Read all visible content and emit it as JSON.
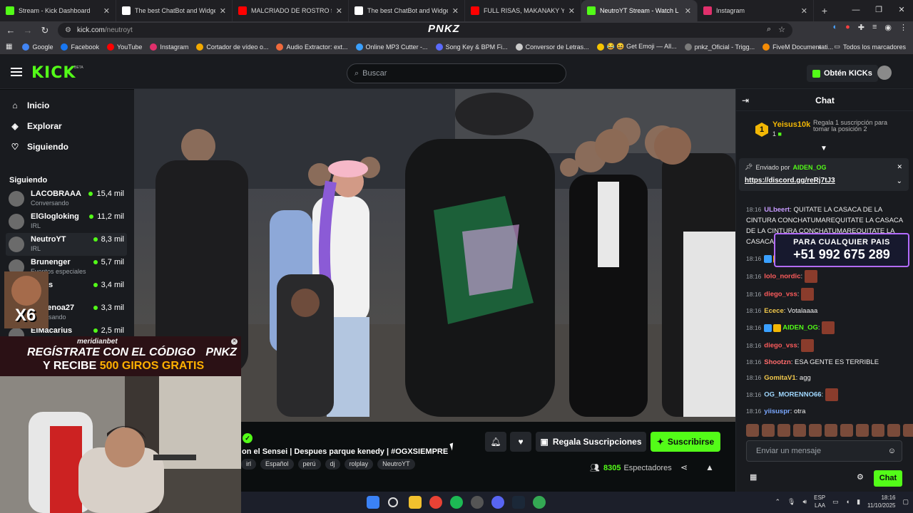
{
  "browser": {
    "tabs": [
      {
        "title": "Stream - Kick Dashboard",
        "icon": "kick-icon",
        "color": "#53fc18"
      },
      {
        "title": "The best ChatBot and Widgets",
        "icon": "botrix-icon",
        "color": "#ffffff"
      },
      {
        "title": "MALCRIADO DE ROSTRO ft. PN",
        "icon": "youtube-icon",
        "color": "#ff0000"
      },
      {
        "title": "The best ChatBot and Widgets",
        "icon": "botrix-icon",
        "color": "#ffffff"
      },
      {
        "title": "FULL RISAS, MAKANAKY Y",
        "icon": "youtube-icon",
        "color": "#ff0000"
      },
      {
        "title": "NeutroYT Stream - Watch L",
        "icon": "kick-icon",
        "color": "#53fc18"
      },
      {
        "title": "Instagram",
        "icon": "instagram-icon",
        "color": "#e1306c"
      }
    ],
    "url_host": "kick.com",
    "url_path": "/neutroyt",
    "overlay_logo": "PNKZ",
    "bookmarks": [
      {
        "label": "Google",
        "color": "#4285f4"
      },
      {
        "label": "Facebook",
        "color": "#1877f2"
      },
      {
        "label": "YouTube",
        "color": "#ff0000"
      },
      {
        "label": "Instagram",
        "color": "#e1306c"
      },
      {
        "label": "Cortador de vídeo o...",
        "color": "#f2a900"
      },
      {
        "label": "Audio Extractor: ext...",
        "color": "#f06a3c"
      },
      {
        "label": "Online MP3 Cutter -...",
        "color": "#3aa0ff"
      },
      {
        "label": "Song Key & BPM Fi...",
        "color": "#5b6bff"
      },
      {
        "label": "Conversor de Letras...",
        "color": "#cccccc"
      },
      {
        "label": "😂 😆 Get Emoji — All...",
        "color": "#f5c400"
      },
      {
        "label": "pnkz_Oficial - Trigg...",
        "color": "#7a7a7a"
      },
      {
        "label": "FiveM Documentati...",
        "color": "#f48c06"
      }
    ],
    "all_bookmarks": "Todos los marcadores"
  },
  "kick": {
    "logo": "KICK",
    "beta": "BETA",
    "search_placeholder": "Buscar",
    "kicks_button": "Obtén KICKs",
    "nav": [
      {
        "label": "Inicio",
        "icon": "home-icon"
      },
      {
        "label": "Explorar",
        "icon": "compass-icon"
      },
      {
        "label": "Siguiendo",
        "icon": "heart-icon"
      }
    ],
    "following_heading": "Siguiendo",
    "channels": [
      {
        "name": "LACOBRAAA",
        "category": "Conversando",
        "viewers": "15,4 mil"
      },
      {
        "name": "ElGlogloking",
        "category": "IRL",
        "viewers": "11,2 mil"
      },
      {
        "name": "NeutroYT",
        "category": "IRL",
        "viewers": "8,3 mil"
      },
      {
        "name": "Brunenger",
        "category": "Eventos especiales",
        "viewers": "5,7 mil"
      },
      {
        "name": "...ukis",
        "category": "",
        "viewers": "3,4 mil"
      },
      {
        "name": "...rmenoa27",
        "category": "...nversando",
        "viewers": "3,3 mil"
      },
      {
        "name": "ElMacarius",
        "category": "",
        "viewers": "2,5 mil"
      }
    ]
  },
  "stream": {
    "title": "on el Sensei | Despues parque kenedy | #OGXSIEMPRE",
    "tags": [
      "irl",
      "Español",
      "perú",
      "dj",
      "rolplay",
      "NeutroYT"
    ],
    "gift_button": "Regala Suscripciones",
    "subscribe_button": "Suscribirse",
    "viewers_count": "8305",
    "viewers_label": "Espectadores"
  },
  "overlay": {
    "ad_brand": "meridianbet",
    "ad_line1": "REGÍSTRATE CON EL CÓDIGO",
    "ad_code": "PNKZ",
    "ad_line2_a": "Y RECIBE",
    "ad_line2_b": "500 GIROS GRATIS",
    "sticker": "X6",
    "phone_label": "PARA CUALQUIER PAIS",
    "phone_number": "+51 992 675 289"
  },
  "chat": {
    "title": "Chat",
    "leader": {
      "rank": "1",
      "name": "Yeisus10k",
      "count": "1",
      "gift_text": "Regala 1 suscripción para tomar la posición 2"
    },
    "pinned": {
      "sent_by": "Enviado por",
      "user": "AIDEN_OG",
      "link": "https://discord.gg/reRj7tJ3"
    },
    "messages": [
      {
        "time": "18:16",
        "user": "ULbeert",
        "color": "#c79bff",
        "text": "QUITATE LA CASACA DE LA CINTURA CONCHATUMAREQUITATE LA CASACA DE LA CINTURA CONCHATUMAREQUITATE LA CASACA DE LA CINTURA"
      },
      {
        "time": "18:16",
        "user": "AIDEN_OG",
        "color": "#53fc18",
        "text": ""
      },
      {
        "time": "18:16",
        "user": "lolo_nordic",
        "color": "#ff5c5c",
        "text": ""
      },
      {
        "time": "18:16",
        "user": "diego_vss",
        "color": "#ff5c5c",
        "text": ""
      },
      {
        "time": "18:16",
        "user": "Ecece",
        "color": "#f2c94c",
        "text": "Votalaaaa"
      },
      {
        "time": "18:16",
        "user": "AIDEN_OG",
        "color": "#53fc18",
        "text": ""
      },
      {
        "time": "18:16",
        "user": "diego_vss",
        "color": "#ff5c5c",
        "text": ""
      },
      {
        "time": "18:16",
        "user": "Shootzn",
        "color": "#ff6b6b",
        "text": "ESA GENTE ES TERRIBLE"
      },
      {
        "time": "18:16",
        "user": "GomitaV1",
        "color": "#f2c94c",
        "text": "agg"
      },
      {
        "time": "18:16",
        "user": "OG_MORENNO66",
        "color": "#a0d8ff",
        "text": ""
      },
      {
        "time": "18:16",
        "user": "yiisuspr",
        "color": "#7aa7ff",
        "text": "otra"
      }
    ],
    "input_placeholder": "Enviar un mensaje",
    "send_button": "Chat"
  },
  "taskbar": {
    "lang": "ESP",
    "lang2": "LAA",
    "time": "18:16",
    "date": "11/10/2025"
  }
}
